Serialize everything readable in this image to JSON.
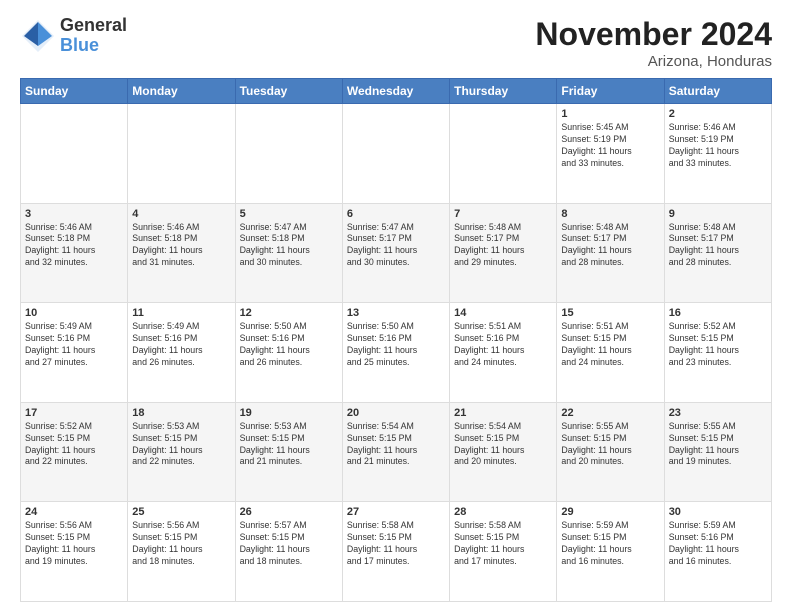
{
  "logo": {
    "general": "General",
    "blue": "Blue",
    "icon": "▶"
  },
  "title": "November 2024",
  "location": "Arizona, Honduras",
  "days_of_week": [
    "Sunday",
    "Monday",
    "Tuesday",
    "Wednesday",
    "Thursday",
    "Friday",
    "Saturday"
  ],
  "weeks": [
    [
      {
        "day": "",
        "info": ""
      },
      {
        "day": "",
        "info": ""
      },
      {
        "day": "",
        "info": ""
      },
      {
        "day": "",
        "info": ""
      },
      {
        "day": "",
        "info": ""
      },
      {
        "day": "1",
        "info": "Sunrise: 5:45 AM\nSunset: 5:19 PM\nDaylight: 11 hours\nand 33 minutes."
      },
      {
        "day": "2",
        "info": "Sunrise: 5:46 AM\nSunset: 5:19 PM\nDaylight: 11 hours\nand 33 minutes."
      }
    ],
    [
      {
        "day": "3",
        "info": "Sunrise: 5:46 AM\nSunset: 5:18 PM\nDaylight: 11 hours\nand 32 minutes."
      },
      {
        "day": "4",
        "info": "Sunrise: 5:46 AM\nSunset: 5:18 PM\nDaylight: 11 hours\nand 31 minutes."
      },
      {
        "day": "5",
        "info": "Sunrise: 5:47 AM\nSunset: 5:18 PM\nDaylight: 11 hours\nand 30 minutes."
      },
      {
        "day": "6",
        "info": "Sunrise: 5:47 AM\nSunset: 5:17 PM\nDaylight: 11 hours\nand 30 minutes."
      },
      {
        "day": "7",
        "info": "Sunrise: 5:48 AM\nSunset: 5:17 PM\nDaylight: 11 hours\nand 29 minutes."
      },
      {
        "day": "8",
        "info": "Sunrise: 5:48 AM\nSunset: 5:17 PM\nDaylight: 11 hours\nand 28 minutes."
      },
      {
        "day": "9",
        "info": "Sunrise: 5:48 AM\nSunset: 5:17 PM\nDaylight: 11 hours\nand 28 minutes."
      }
    ],
    [
      {
        "day": "10",
        "info": "Sunrise: 5:49 AM\nSunset: 5:16 PM\nDaylight: 11 hours\nand 27 minutes."
      },
      {
        "day": "11",
        "info": "Sunrise: 5:49 AM\nSunset: 5:16 PM\nDaylight: 11 hours\nand 26 minutes."
      },
      {
        "day": "12",
        "info": "Sunrise: 5:50 AM\nSunset: 5:16 PM\nDaylight: 11 hours\nand 26 minutes."
      },
      {
        "day": "13",
        "info": "Sunrise: 5:50 AM\nSunset: 5:16 PM\nDaylight: 11 hours\nand 25 minutes."
      },
      {
        "day": "14",
        "info": "Sunrise: 5:51 AM\nSunset: 5:16 PM\nDaylight: 11 hours\nand 24 minutes."
      },
      {
        "day": "15",
        "info": "Sunrise: 5:51 AM\nSunset: 5:15 PM\nDaylight: 11 hours\nand 24 minutes."
      },
      {
        "day": "16",
        "info": "Sunrise: 5:52 AM\nSunset: 5:15 PM\nDaylight: 11 hours\nand 23 minutes."
      }
    ],
    [
      {
        "day": "17",
        "info": "Sunrise: 5:52 AM\nSunset: 5:15 PM\nDaylight: 11 hours\nand 22 minutes."
      },
      {
        "day": "18",
        "info": "Sunrise: 5:53 AM\nSunset: 5:15 PM\nDaylight: 11 hours\nand 22 minutes."
      },
      {
        "day": "19",
        "info": "Sunrise: 5:53 AM\nSunset: 5:15 PM\nDaylight: 11 hours\nand 21 minutes."
      },
      {
        "day": "20",
        "info": "Sunrise: 5:54 AM\nSunset: 5:15 PM\nDaylight: 11 hours\nand 21 minutes."
      },
      {
        "day": "21",
        "info": "Sunrise: 5:54 AM\nSunset: 5:15 PM\nDaylight: 11 hours\nand 20 minutes."
      },
      {
        "day": "22",
        "info": "Sunrise: 5:55 AM\nSunset: 5:15 PM\nDaylight: 11 hours\nand 20 minutes."
      },
      {
        "day": "23",
        "info": "Sunrise: 5:55 AM\nSunset: 5:15 PM\nDaylight: 11 hours\nand 19 minutes."
      }
    ],
    [
      {
        "day": "24",
        "info": "Sunrise: 5:56 AM\nSunset: 5:15 PM\nDaylight: 11 hours\nand 19 minutes."
      },
      {
        "day": "25",
        "info": "Sunrise: 5:56 AM\nSunset: 5:15 PM\nDaylight: 11 hours\nand 18 minutes."
      },
      {
        "day": "26",
        "info": "Sunrise: 5:57 AM\nSunset: 5:15 PM\nDaylight: 11 hours\nand 18 minutes."
      },
      {
        "day": "27",
        "info": "Sunrise: 5:58 AM\nSunset: 5:15 PM\nDaylight: 11 hours\nand 17 minutes."
      },
      {
        "day": "28",
        "info": "Sunrise: 5:58 AM\nSunset: 5:15 PM\nDaylight: 11 hours\nand 17 minutes."
      },
      {
        "day": "29",
        "info": "Sunrise: 5:59 AM\nSunset: 5:15 PM\nDaylight: 11 hours\nand 16 minutes."
      },
      {
        "day": "30",
        "info": "Sunrise: 5:59 AM\nSunset: 5:16 PM\nDaylight: 11 hours\nand 16 minutes."
      }
    ]
  ]
}
